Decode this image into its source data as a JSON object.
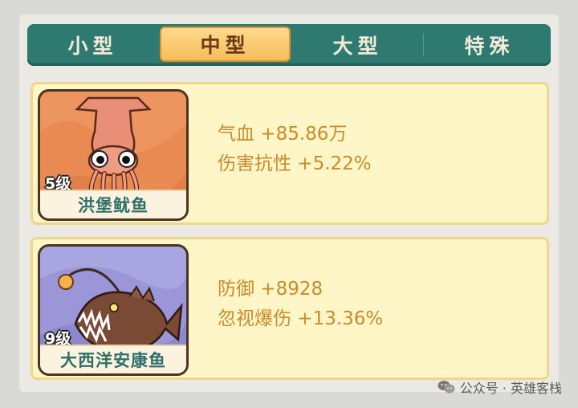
{
  "tabs": [
    {
      "label": "小型",
      "active": false
    },
    {
      "label": "中型",
      "active": true
    },
    {
      "label": "大型",
      "active": false
    },
    {
      "label": "特殊",
      "active": false
    }
  ],
  "cards": [
    {
      "level": "5级",
      "name": "洪堡鱿鱼",
      "icon": "squid-icon",
      "stats": [
        "气血 +85.86万",
        "伤害抗性 +5.22%"
      ]
    },
    {
      "level": "9级",
      "name": "大西洋安康鱼",
      "icon": "anglerfish-icon",
      "stats": [
        "防御 +8928",
        "忽视爆伤 +13.36%"
      ]
    }
  ],
  "watermark": {
    "text": "公众号 · 英雄客栈",
    "icon": "wechat-icon"
  },
  "colors": {
    "tab_bar": "#2f7a70",
    "tab_active": "#f5bd5a",
    "card_bg": "#fff6c8",
    "stat_text": "#c98b2a",
    "name_text": "#2f6f68"
  }
}
